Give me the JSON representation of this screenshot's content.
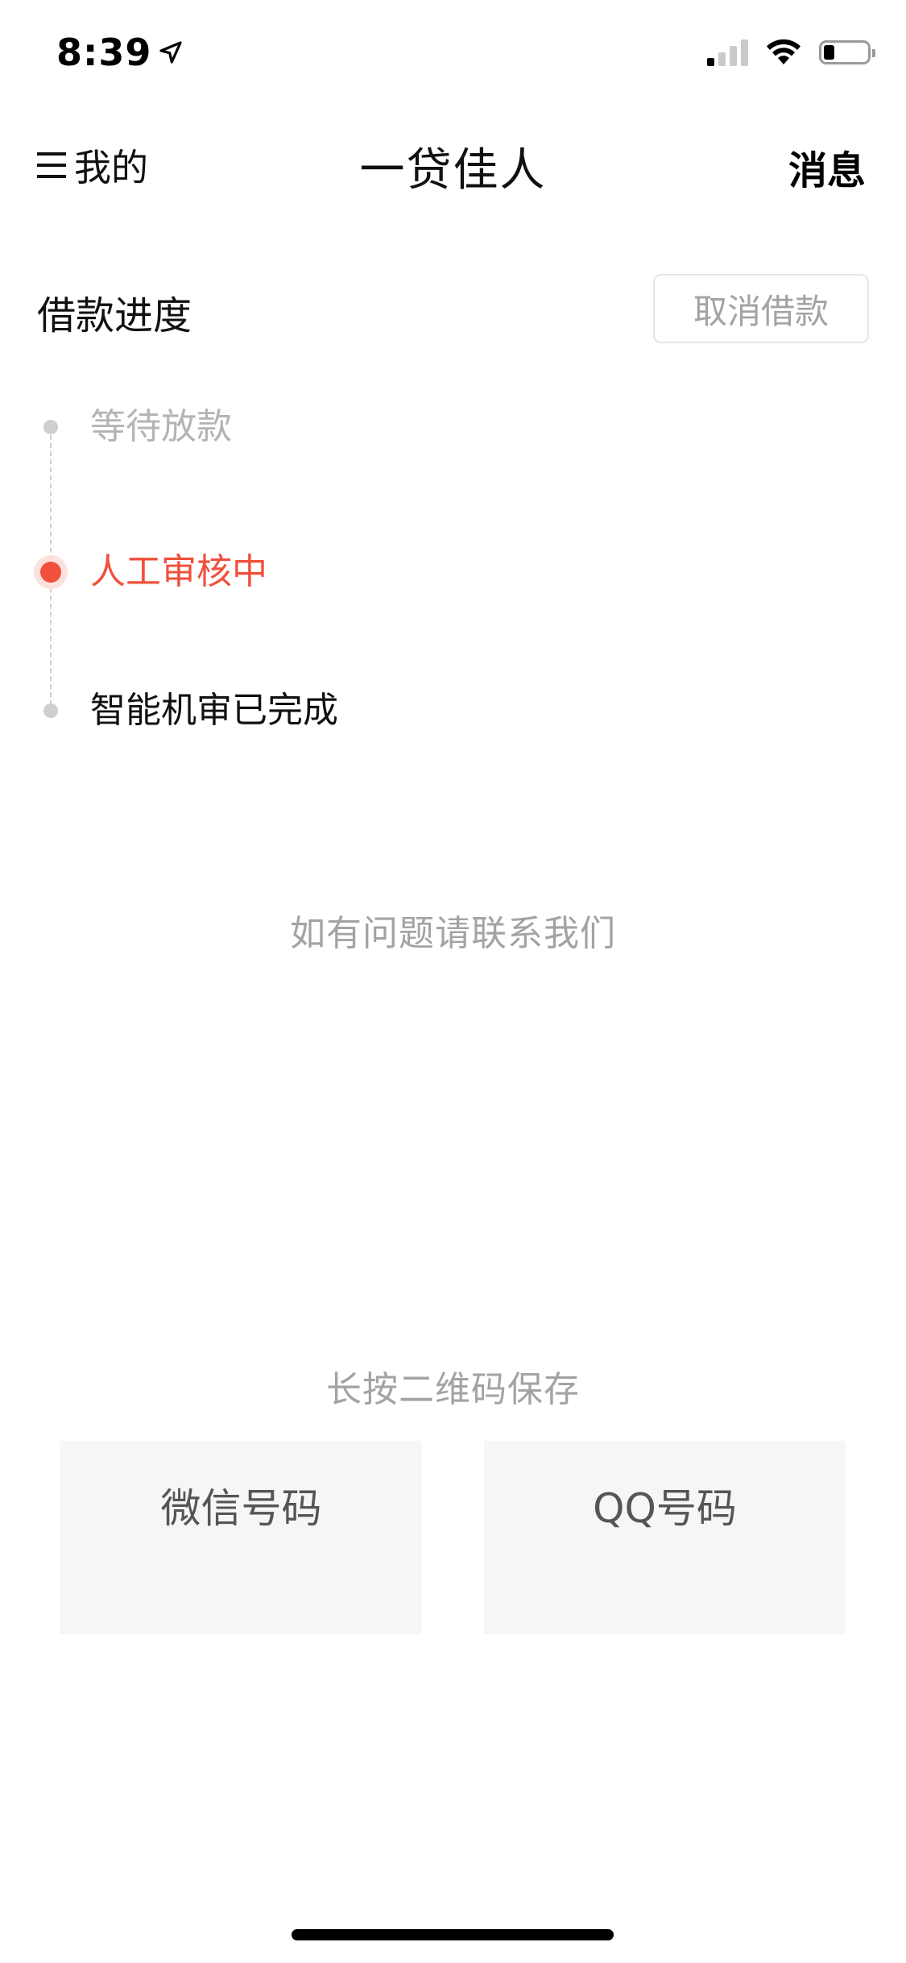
{
  "status_bar": {
    "time": "8:39",
    "battery_level": 0.25
  },
  "nav": {
    "left_label": "我的",
    "title": "一贷佳人",
    "right_label": "消息"
  },
  "progress": {
    "title": "借款进度",
    "cancel_label": "取消借款",
    "steps": [
      {
        "label": "等待放款",
        "state": "pending"
      },
      {
        "label": "人工审核中",
        "state": "active"
      },
      {
        "label": "智能机审已完成",
        "state": "done"
      }
    ]
  },
  "contact_hint": "如有问题请联系我们",
  "qr": {
    "hint": "长按二维码保存",
    "cards": [
      {
        "label": "微信号码"
      },
      {
        "label": "QQ号码"
      }
    ]
  },
  "colors": {
    "accent": "#f0503c",
    "muted": "#a3a3a3",
    "card_bg": "#f6f6f6"
  }
}
